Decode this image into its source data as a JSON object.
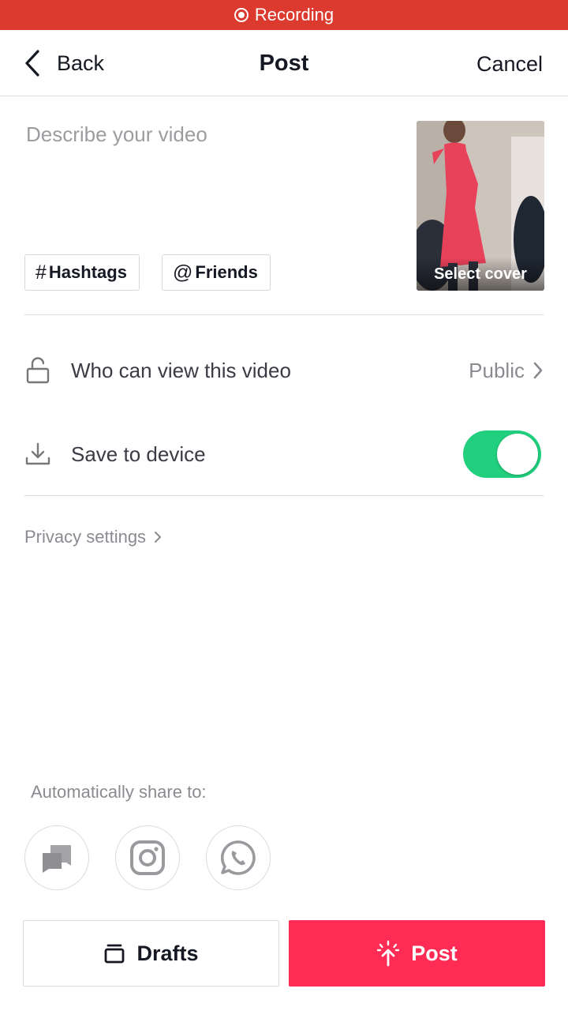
{
  "status_bar": {
    "text": "Recording",
    "icon": "record-icon",
    "color": "#dc3a2f"
  },
  "nav": {
    "back_label": "Back",
    "title": "Post",
    "cancel_label": "Cancel"
  },
  "description": {
    "placeholder": "Describe your video",
    "value": ""
  },
  "chips": {
    "hashtags_symbol": "#",
    "hashtags_label": "Hashtags",
    "friends_symbol": "@",
    "friends_label": "Friends"
  },
  "cover": {
    "label": "Select cover"
  },
  "settings": {
    "who_can_view": {
      "label": "Who can view this video",
      "value": "Public",
      "icon": "lock-open-icon"
    },
    "save_to_device": {
      "label": "Save to device",
      "enabled": true,
      "icon": "download-icon"
    }
  },
  "privacy_link": "Privacy settings",
  "share": {
    "label": "Automatically share to:",
    "targets": [
      "message-bubble-icon",
      "instagram-icon",
      "whatsapp-icon"
    ]
  },
  "buttons": {
    "drafts_label": "Drafts",
    "post_label": "Post"
  },
  "colors": {
    "accent": "#fe2c55",
    "toggle_on": "#21d07e"
  }
}
